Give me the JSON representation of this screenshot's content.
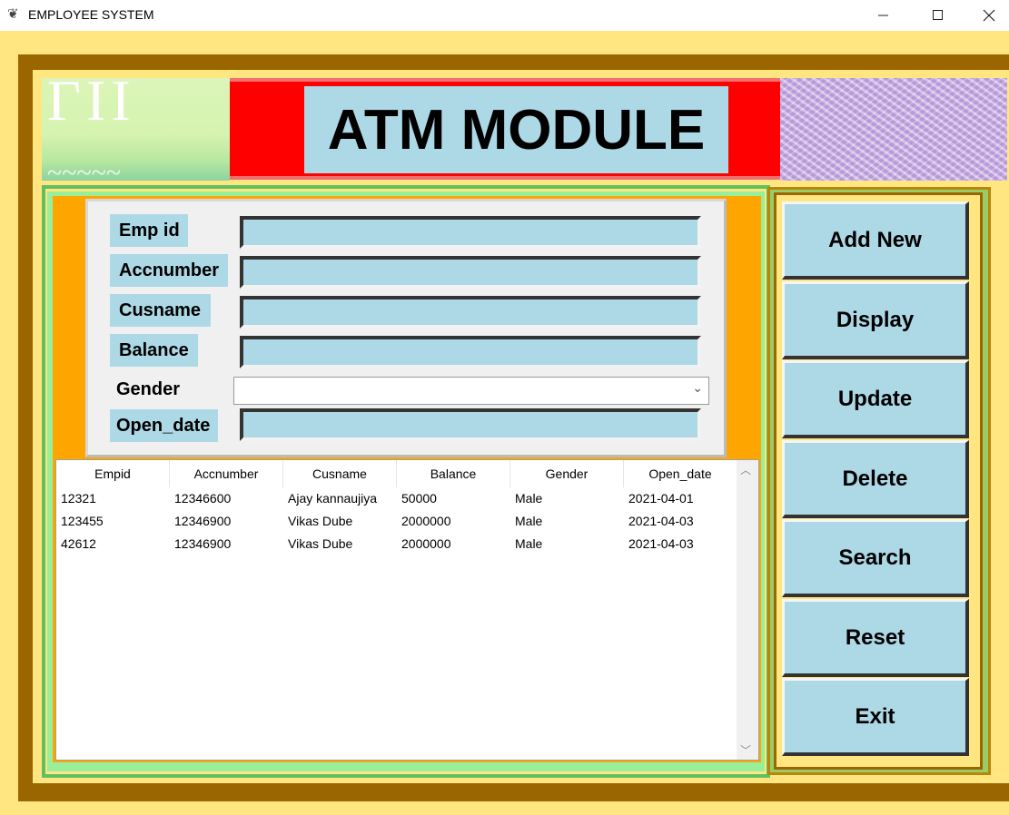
{
  "window": {
    "title": "EMPLOYEE SYSTEM",
    "icon": "feather-icon",
    "controls": [
      "minimize-icon",
      "maximize-icon",
      "close-icon"
    ]
  },
  "header": {
    "title": "ATM MODULE"
  },
  "form": {
    "fields": [
      {
        "label": "Emp id",
        "value": ""
      },
      {
        "label": "Accnumber",
        "value": ""
      },
      {
        "label": "Cusname",
        "value": ""
      },
      {
        "label": "Balance",
        "value": ""
      },
      {
        "label": "Gender",
        "value": ""
      },
      {
        "label": "Open_date",
        "value": ""
      }
    ]
  },
  "table": {
    "columns": [
      "Empid",
      "Accnumber",
      "Cusname",
      "Balance",
      "Gender",
      "Open_date"
    ],
    "rows": [
      [
        "12321",
        "12346600",
        "Ajay kannaujiya",
        "50000",
        "Male",
        "2021-04-01"
      ],
      [
        "123455",
        "12346900",
        "Vikas Dube",
        "2000000",
        "Male",
        "2021-04-03"
      ],
      [
        "42612",
        "12346900",
        "Vikas Dube",
        "2000000",
        "Male",
        "2021-04-03"
      ]
    ]
  },
  "buttons": [
    "Add New",
    "Display",
    "Update",
    "Delete",
    "Search",
    "Reset",
    "Exit"
  ],
  "colors": {
    "background": "#ffe680",
    "frame": "#996600",
    "accent": "#add8e6",
    "header_red": "#ff0000",
    "orange": "#ffa500"
  }
}
